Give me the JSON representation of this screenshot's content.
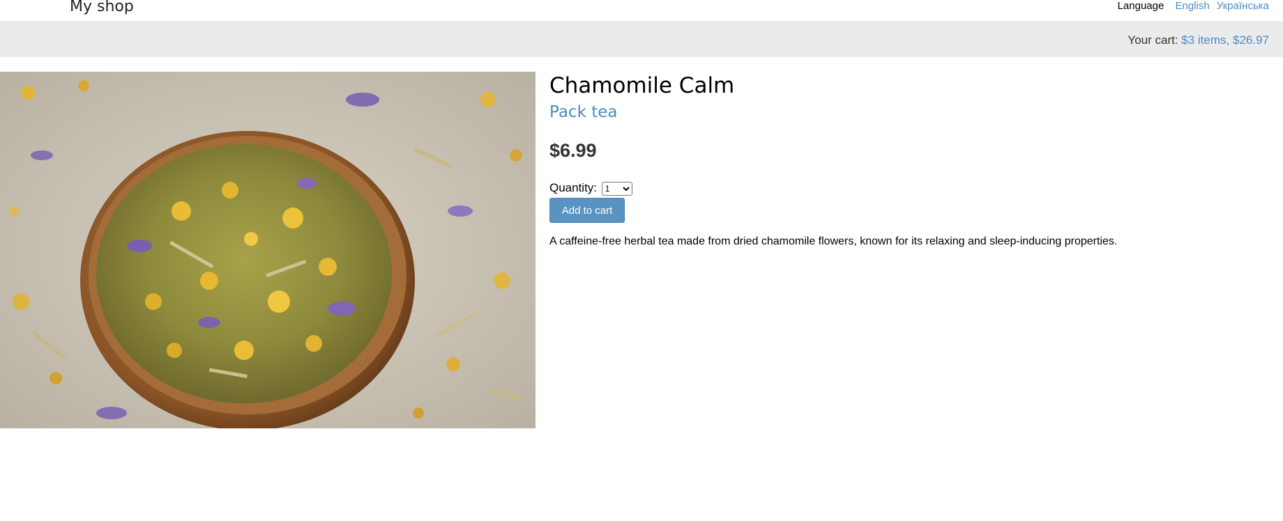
{
  "header": {
    "logo": "My shop",
    "language_label": "Language",
    "languages": [
      "English",
      "Українська"
    ]
  },
  "cart": {
    "label": "Your cart:",
    "summary": "$3 items, $26.97"
  },
  "product": {
    "image_alt": "Chamomile Calm",
    "name": "Chamomile Calm",
    "category": "Pack tea",
    "price": "$6.99",
    "quantity_label": "Quantity:",
    "quantity_selected": "1",
    "add_button": "Add to cart",
    "description": "A caffeine-free herbal tea made from dried chamomile flowers, known for its relaxing and sleep-inducing properties."
  },
  "colors": {
    "link": "#4a8cc2",
    "button": "#5993c0",
    "cartbar": "#ebebeb"
  }
}
